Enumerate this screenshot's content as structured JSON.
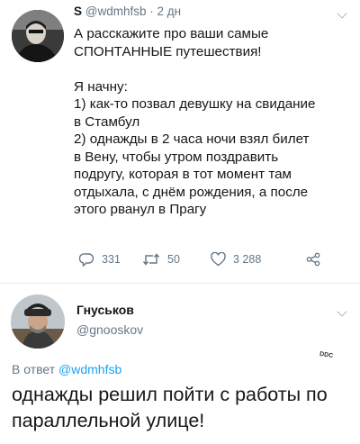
{
  "tweet": {
    "name": "S",
    "handle": "@wdmhfsb",
    "separator": "·",
    "time": "2 дн",
    "text": "А расскажите про ваши самые\nСПОНТАННЫЕ путешествия!\n\nЯ начну:\n1) как-то позвал девушку на свидание\nв Стамбул\n2) однажды в 2 часа ночи взял билет\nв Вену, чтобы утром поздравить\nподругу, которая в тот момент там\nотдыхала, с днём рождения, а после\nэтого рванул в Прагу",
    "replies": "331",
    "retweets": "50",
    "likes": "3 288"
  },
  "reply": {
    "name": "Гнуськов",
    "handle": "@gnooskov",
    "replying_prefix": "В ответ",
    "replying_to": "@wdmhfsb",
    "text": "однажды решил пойти с работы по параллельной улице!"
  },
  "watermark": "DDC",
  "icons": [
    "avatar",
    "chevron-down-icon",
    "reply-icon",
    "retweet-icon",
    "like-icon",
    "share-icon"
  ],
  "colors": {
    "link": "#1da1f2",
    "secondary": "#657786",
    "text": "#14171a"
  }
}
